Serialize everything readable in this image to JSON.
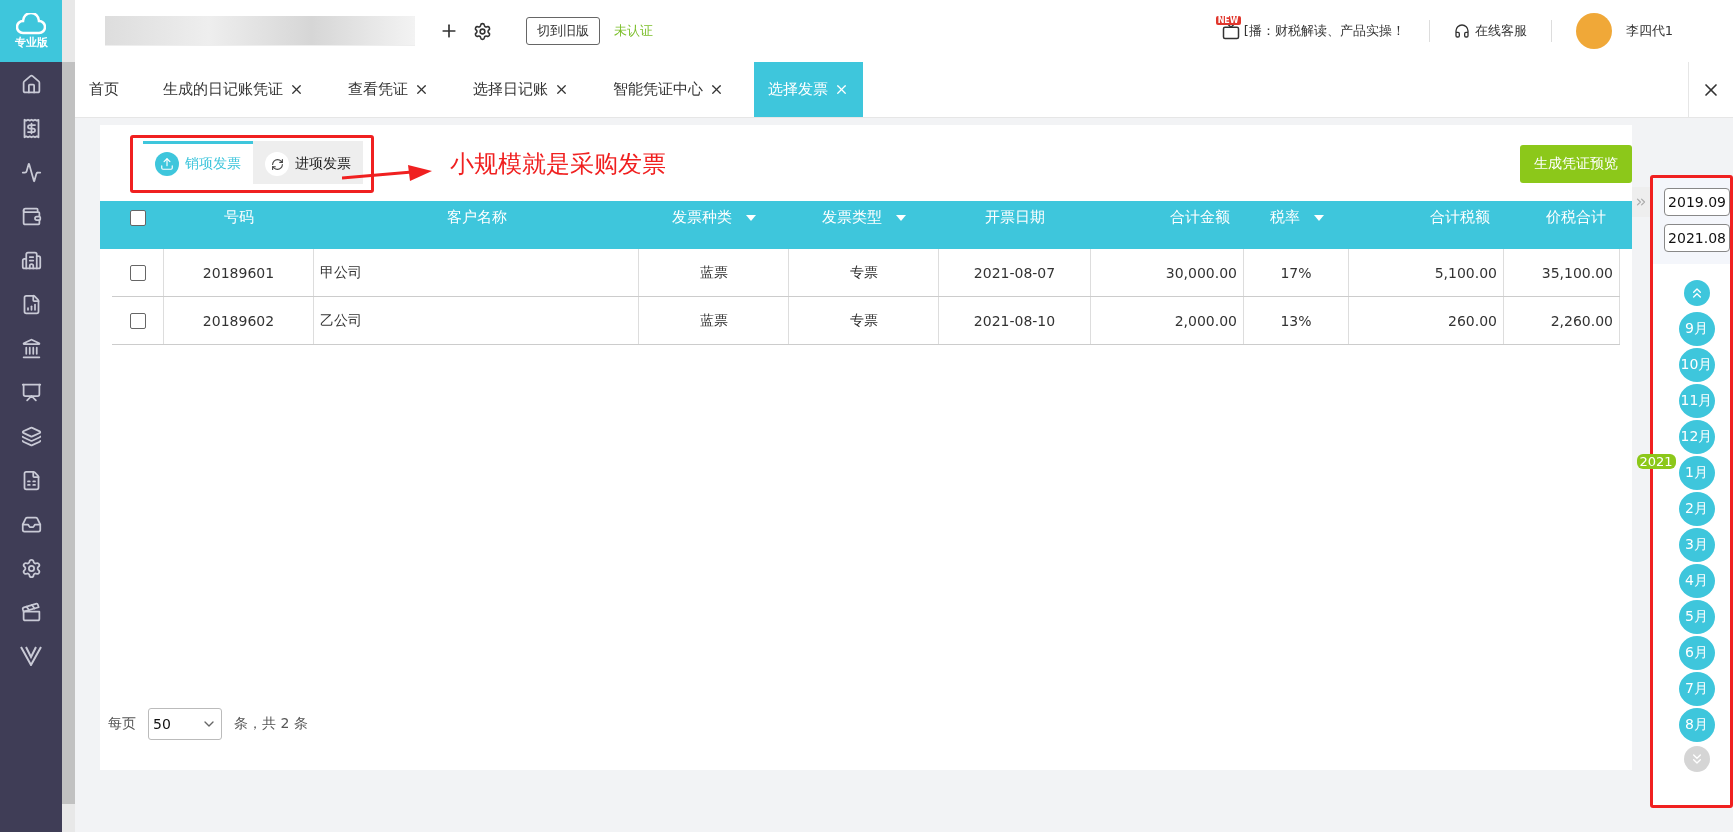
{
  "brand": {
    "edition": "专业版"
  },
  "header": {
    "switch_button": "切到旧版",
    "auth_status": "未认证",
    "news_badge": "NEW",
    "news": "[播：财税解读、产品实操！",
    "support": "在线客服",
    "user": "李四代1"
  },
  "tabs": [
    {
      "label": "首页",
      "closable": false,
      "selected": false
    },
    {
      "label": "生成的日记账凭证",
      "closable": true,
      "selected": false
    },
    {
      "label": "查看凭证",
      "closable": true,
      "selected": false
    },
    {
      "label": "选择日记账",
      "closable": true,
      "selected": false
    },
    {
      "label": "智能凭证中心",
      "closable": true,
      "selected": false
    },
    {
      "label": "选择发票",
      "closable": true,
      "selected": true
    }
  ],
  "subtabs": [
    {
      "label": "销项发票",
      "selected": true
    },
    {
      "label": "进项发票",
      "selected": false
    }
  ],
  "annotation": {
    "text": "小规模就是采购发票"
  },
  "generate_button": "生成凭证预览",
  "table": {
    "all_checked": false,
    "columns": [
      {
        "label": "号码",
        "kind": "center",
        "filter": false
      },
      {
        "label": "客户名称",
        "kind": "name",
        "filter": false
      },
      {
        "label": "发票种类",
        "kind": "center",
        "filter": true
      },
      {
        "label": "发票类型",
        "kind": "center",
        "filter": true
      },
      {
        "label": "开票日期",
        "kind": "center",
        "filter": false
      },
      {
        "label": "合计金额",
        "kind": "amount",
        "filter": false
      },
      {
        "label": "税率",
        "kind": "center",
        "filter": true
      },
      {
        "label": "合计税额",
        "kind": "amount",
        "filter": false
      },
      {
        "label": "价税合计",
        "kind": "amount",
        "filter": false
      }
    ],
    "rows": [
      {
        "checked": false,
        "cells": [
          "20189601",
          "甲公司",
          "蓝票",
          "专票",
          "2021-08-07",
          "30,000.00",
          "17%",
          "5,100.00",
          "35,100.00"
        ]
      },
      {
        "checked": false,
        "cells": [
          "20189602",
          "乙公司",
          "蓝票",
          "专票",
          "2021-08-10",
          "2,000.00",
          "13%",
          "260.00",
          "2,260.00"
        ]
      }
    ]
  },
  "pagination": {
    "per_page_label": "每页",
    "per_page": "50",
    "summary": "条，共 2 条"
  },
  "date_range": {
    "start": "2019.09",
    "end": "2021.08"
  },
  "month_nav": {
    "up_disabled": false,
    "down_disabled": true
  },
  "months": [
    {
      "label": "9月"
    },
    {
      "label": "10月"
    },
    {
      "label": "11月"
    },
    {
      "label": "12月"
    },
    {
      "label": "1月",
      "year": "2021"
    },
    {
      "label": "2月"
    },
    {
      "label": "3月"
    },
    {
      "label": "4月"
    },
    {
      "label": "5月"
    },
    {
      "label": "6月"
    },
    {
      "label": "7月"
    },
    {
      "label": "8月"
    }
  ]
}
